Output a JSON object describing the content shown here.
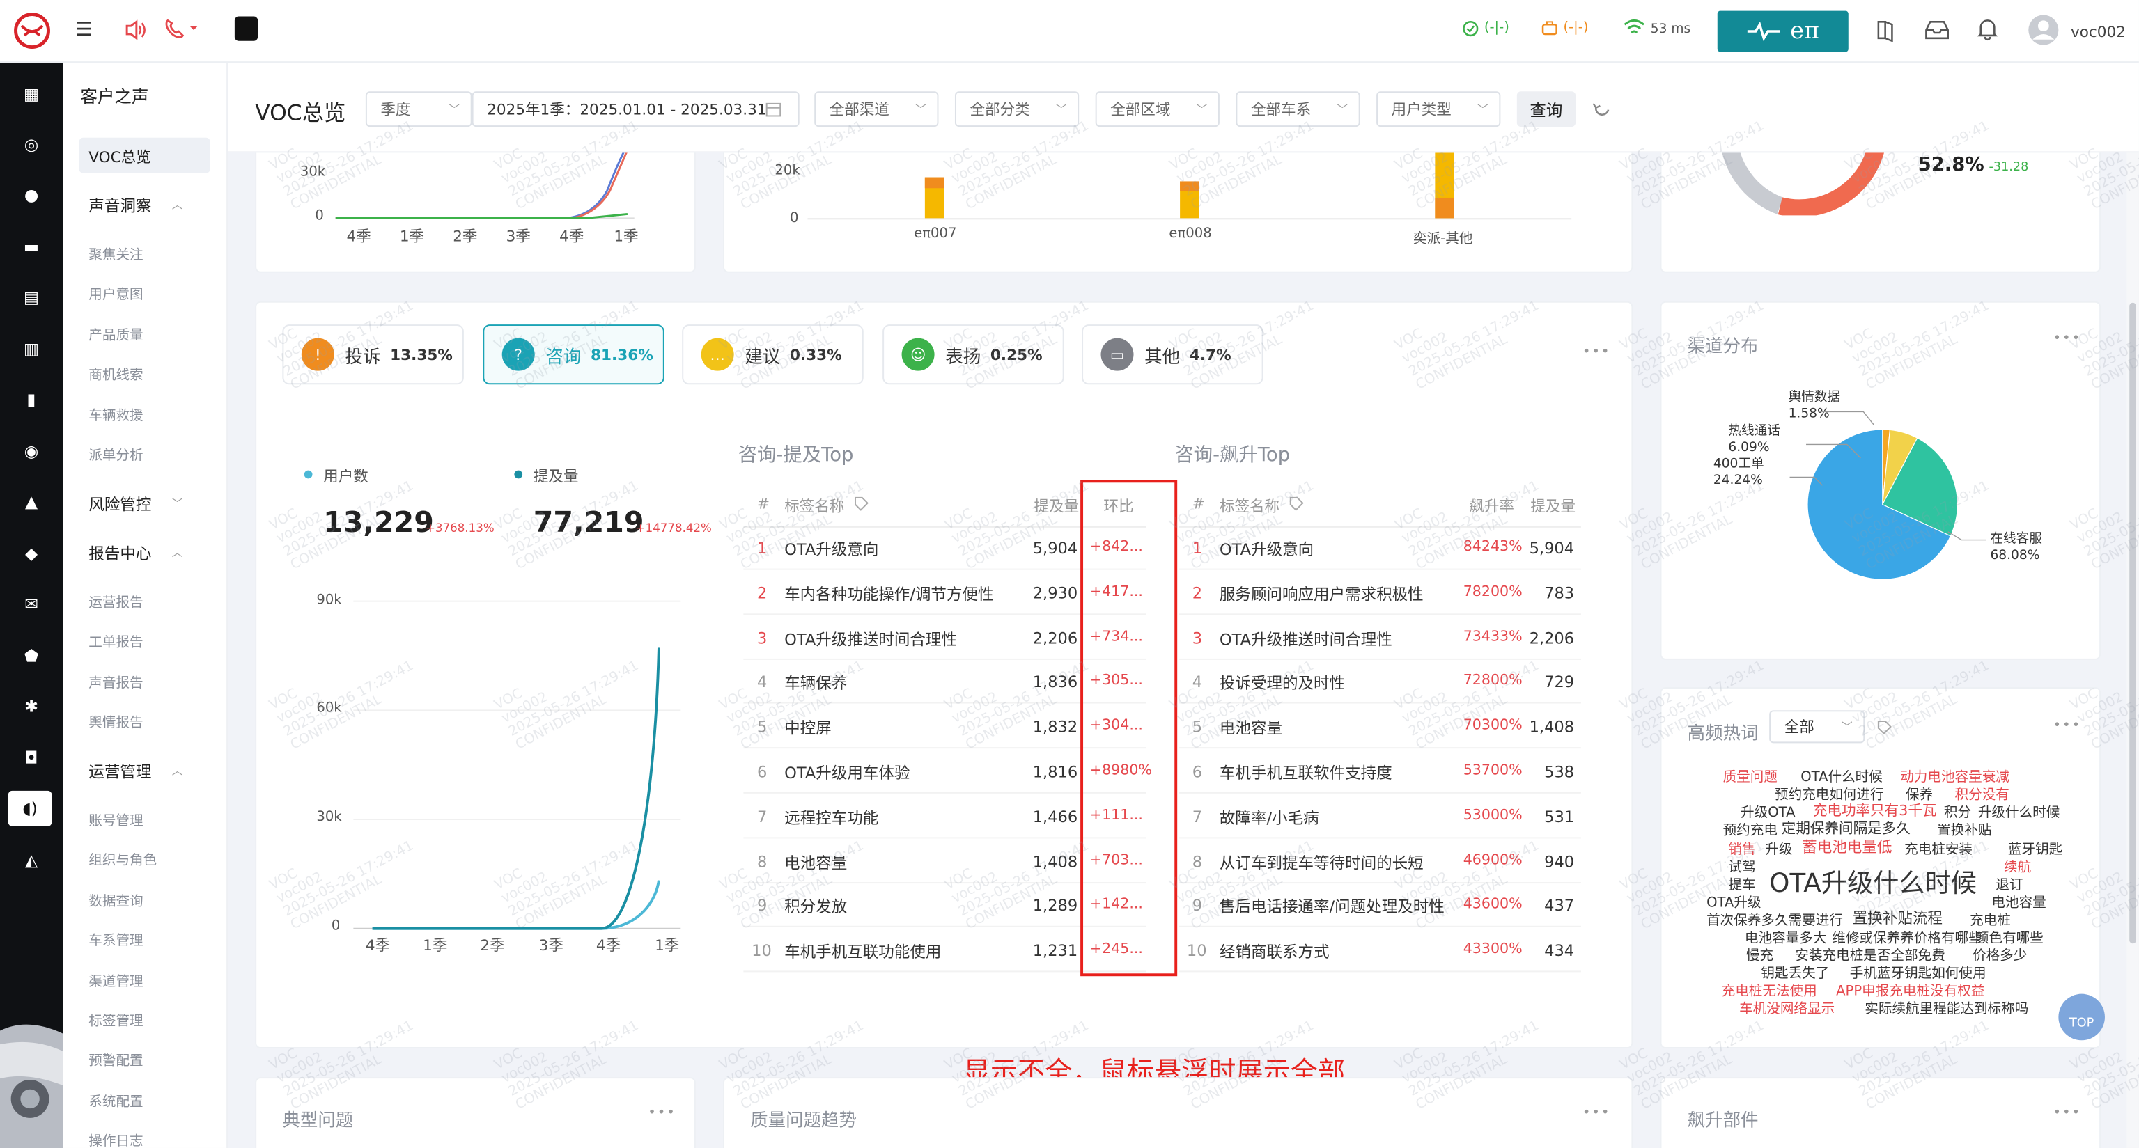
{
  "header": {
    "latency": "53 ms",
    "status1": "(-|-)",
    "status2": "(-|-)",
    "brand": "eπ",
    "user": "voc002"
  },
  "subnav": {
    "title": "客户之声",
    "active": "VOC总览",
    "groups": [
      {
        "label": "声音洞察",
        "items": [
          "聚焦关注",
          "用户意图",
          "产品质量",
          "商机线索",
          "车辆救援",
          "派单分析"
        ]
      },
      {
        "label": "风险管控",
        "items": []
      },
      {
        "label": "报告中心",
        "items": [
          "运营报告",
          "工单报告",
          "声音报告",
          "舆情报告"
        ]
      },
      {
        "label": "运营管理",
        "items": [
          "账号管理",
          "组织与角色",
          "数据查询",
          "车系管理",
          "渠道管理",
          "标签管理",
          "预警配置",
          "系统配置",
          "操作日志"
        ]
      }
    ]
  },
  "page": {
    "title": "VOC总览",
    "period_type": "季度",
    "date_range": "2025年1季：2025.01.01 - 2025.03.31",
    "channel": "全部渠道",
    "category": "全部分类",
    "region": "全部区域",
    "series": "全部车系",
    "user_type": "用户类型",
    "query": "查询"
  },
  "watermark": {
    "a": "VOC",
    "b": "voc002",
    "c": "2025-05-26 17:29:41",
    "d": "CONFIDENTIAL"
  },
  "top_left_chart": {
    "ytick_30k": "30k",
    "ytick_0": "0",
    "x": [
      "4季",
      "1季",
      "2季",
      "3季",
      "4季",
      "1季"
    ]
  },
  "top_mid_chart": {
    "ytick_20k": "20k",
    "ytick_0": "0",
    "categories": [
      "eπ007",
      "eπ008",
      "奕派-其他"
    ]
  },
  "top_right": {
    "percent": "52.8%",
    "delta": "-31.28"
  },
  "tabs": [
    {
      "label": "投诉",
      "pct": "13.35%",
      "icon": "complaint-icon",
      "color": "#f08c1e"
    },
    {
      "label": "咨询",
      "pct": "81.36%",
      "icon": "consult-icon",
      "color": "#1aa3b5"
    },
    {
      "label": "建议",
      "pct": "0.33%",
      "icon": "suggest-icon",
      "color": "#f2c318"
    },
    {
      "label": "表扬",
      "pct": "0.25%",
      "icon": "praise-icon",
      "color": "#3cb24a"
    },
    {
      "label": "其他",
      "pct": "4.7%",
      "icon": "other-icon",
      "color": "#7d7f86"
    }
  ],
  "kpi": {
    "users_label": "用户数",
    "users": "13,229",
    "users_delta": "+3768.13%",
    "mentions_label": "提及量",
    "mentions": "77,219",
    "mentions_delta": "+14778.42%"
  },
  "main_chart": {
    "ytick_90k": "90k",
    "ytick_60k": "60k",
    "ytick_30k": "30k",
    "ytick_0": "0",
    "x": [
      "4季",
      "1季",
      "2季",
      "3季",
      "4季",
      "1季"
    ]
  },
  "chart_data": {
    "type": "line",
    "categories": [
      "4季",
      "1季",
      "2季",
      "3季",
      "4季",
      "1季"
    ],
    "series": [
      {
        "name": "用户数",
        "values": [
          0,
          0,
          0,
          0,
          0,
          13229
        ]
      },
      {
        "name": "提及量",
        "values": [
          0,
          0,
          0,
          0,
          0,
          77219
        ]
      }
    ],
    "ylim": [
      0,
      90000
    ]
  },
  "mention_top": {
    "title": "咨询-提及Top",
    "col_idx": "#",
    "col_name": "标签名称",
    "col_count": "提及量",
    "col_change": "环比",
    "rows": [
      {
        "i": "1",
        "name": "OTA升级意向",
        "count": "5,904",
        "change": "+842..."
      },
      {
        "i": "2",
        "name": "车内各种功能操作/调节方便性",
        "count": "2,930",
        "change": "+417..."
      },
      {
        "i": "3",
        "name": "OTA升级推送时间合理性",
        "count": "2,206",
        "change": "+734..."
      },
      {
        "i": "4",
        "name": "车辆保养",
        "count": "1,836",
        "change": "+305..."
      },
      {
        "i": "5",
        "name": "中控屏",
        "count": "1,832",
        "change": "+304..."
      },
      {
        "i": "6",
        "name": "OTA升级用车体验",
        "count": "1,816",
        "change": "+8980%"
      },
      {
        "i": "7",
        "name": "远程控车功能",
        "count": "1,466",
        "change": "+111..."
      },
      {
        "i": "8",
        "name": "电池容量",
        "count": "1,408",
        "change": "+703..."
      },
      {
        "i": "9",
        "name": "积分发放",
        "count": "1,289",
        "change": "+142..."
      },
      {
        "i": "10",
        "name": "车机手机互联功能使用",
        "count": "1,231",
        "change": "+245..."
      }
    ]
  },
  "rise_top": {
    "title": "咨询-飙升Top",
    "col_idx": "#",
    "col_name": "标签名称",
    "col_rate": "飙升率",
    "col_count": "提及量",
    "rows": [
      {
        "i": "1",
        "name": "OTA升级意向",
        "rate": "84243%",
        "count": "5,904"
      },
      {
        "i": "2",
        "name": "服务顾问响应用户需求积极性",
        "rate": "78200%",
        "count": "783"
      },
      {
        "i": "3",
        "name": "OTA升级推送时间合理性",
        "rate": "73433%",
        "count": "2,206"
      },
      {
        "i": "4",
        "name": "投诉受理的及时性",
        "rate": "72800%",
        "count": "729"
      },
      {
        "i": "5",
        "name": "电池容量",
        "rate": "70300%",
        "count": "1,408"
      },
      {
        "i": "6",
        "name": "车机手机互联软件支持度",
        "rate": "53700%",
        "count": "538"
      },
      {
        "i": "7",
        "name": "故障率/小毛病",
        "rate": "53000%",
        "count": "531"
      },
      {
        "i": "8",
        "name": "从订车到提车等待时间的长短",
        "rate": "46900%",
        "count": "940"
      },
      {
        "i": "9",
        "name": "售后电话接通率/问题处理及时性",
        "rate": "43600%",
        "count": "437"
      },
      {
        "i": "10",
        "name": "经销商联系方式",
        "rate": "43300%",
        "count": "434"
      }
    ]
  },
  "annotation": "显示不全，鼠标悬浮时展示全部",
  "channel": {
    "title": "渠道分布",
    "slices": [
      {
        "label": "舆情数据",
        "pct": "1.58%",
        "value": 1.58,
        "color": "#f5a623"
      },
      {
        "label": "热线通话",
        "pct": "6.09%",
        "value": 6.09,
        "color": "#f2d24a"
      },
      {
        "label": "400工单",
        "pct": "24.24%",
        "value": 24.24,
        "color": "#2fc3a0"
      },
      {
        "label": "在线客服",
        "pct": "68.08%",
        "value": 68.08,
        "color": "#3aa6e6"
      }
    ]
  },
  "hotwords": {
    "title": "高频热词",
    "filter": "全部",
    "top_label": "TOP",
    "words": [
      "质量问题",
      "OTA什么时候",
      "动力电池容量衰减",
      "预约充电如何进行",
      "保养",
      "积分没有",
      "升级OTA",
      "充电功率只有3千瓦",
      "积分",
      "升级什么时候",
      "预约充电",
      "定期保养间隔是多久",
      "置换补贴",
      "销售",
      "升级",
      "蓄电池电量低",
      "充电桩安装",
      "蓝牙钥匙",
      "试驾",
      "续航",
      "提车",
      "OTA升级什么时候",
      "退订",
      "OTA升级",
      "电池容量",
      "首次保养多久需要进行",
      "置换补贴流程",
      "充电桩",
      "电池容量多大",
      "维修或保养养价格有哪些",
      "慢充",
      "安装充电桩是否全部免费",
      "价格多少",
      "钥匙丢失了",
      "手机蓝牙钥匙如何使用",
      "颜色有哪些",
      "充电桩无法使用",
      "APP申报充电桩没有权益",
      "车机没网络显示",
      "实际续航里程能达到标称吗"
    ]
  },
  "bottom": {
    "typical": "典型问题",
    "trend": "质量问题趋势",
    "parts": "飙升部件"
  },
  "more": "•••"
}
